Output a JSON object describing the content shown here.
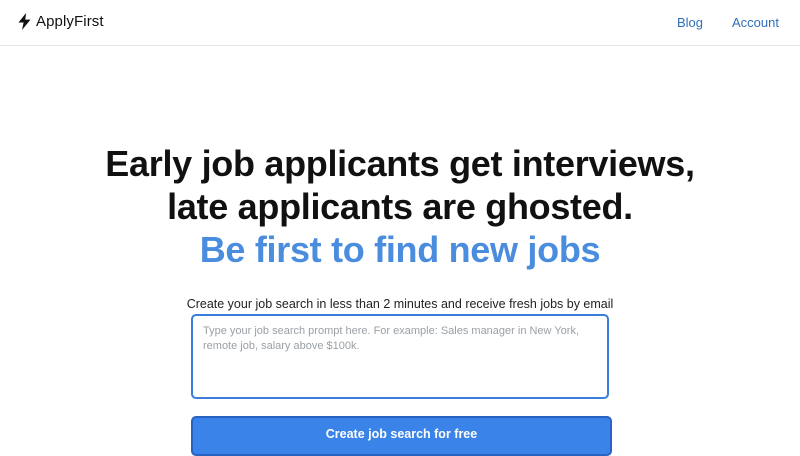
{
  "header": {
    "brand_name": "ApplyFirst",
    "brand_icon": "lightning-bolt-icon",
    "nav": [
      {
        "label": "Blog"
      },
      {
        "label": "Account"
      }
    ]
  },
  "hero": {
    "headline_line1": "Early job applicants get interviews,",
    "headline_line2": "late applicants are ghosted.",
    "headline_accent": "Be first to find new jobs",
    "subtitle": "Create your job search in less than 2 minutes and receive fresh jobs by email"
  },
  "search": {
    "value": "",
    "placeholder": "Type your job search prompt here. For example: Sales manager in New York, remote job, salary above $100k.",
    "cta_label": "Create job search for free"
  },
  "colors": {
    "accent": "#4a8cdd",
    "link": "#2f6fb8",
    "button": "#3a83e8",
    "input_border": "#3b7ddd"
  }
}
